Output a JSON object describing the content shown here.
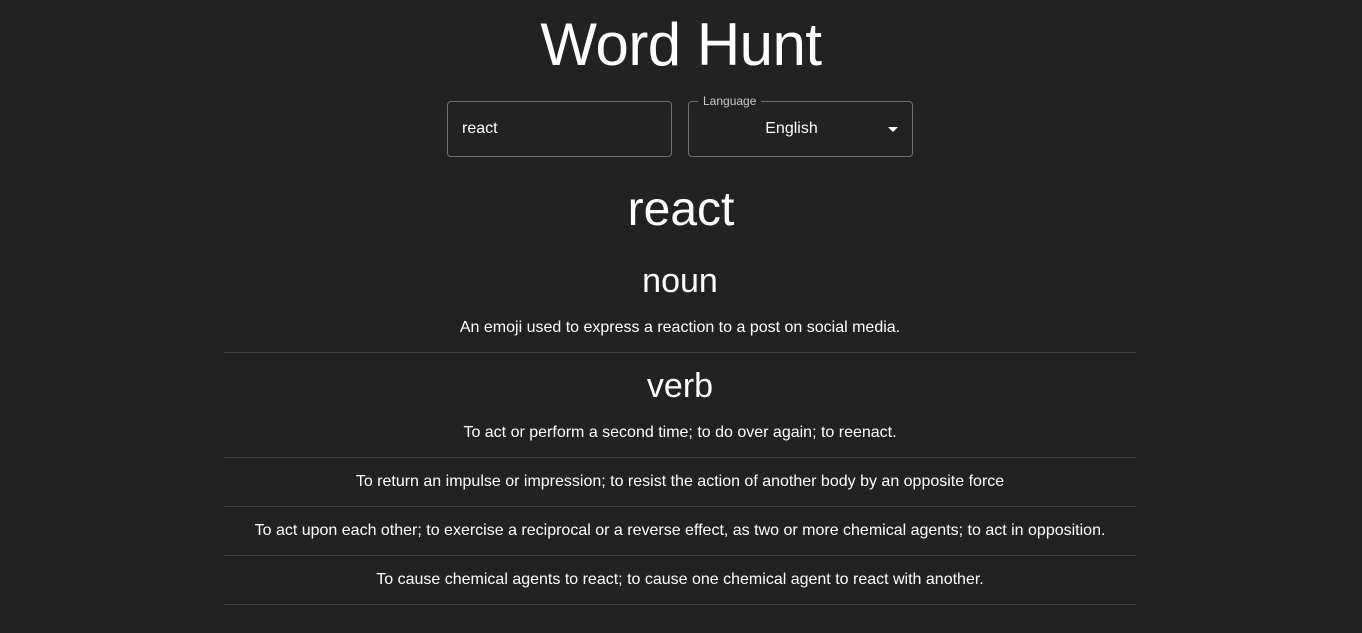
{
  "app": {
    "title": "Word Hunt"
  },
  "search": {
    "value": "react"
  },
  "language": {
    "label": "Language",
    "selected": "English"
  },
  "result": {
    "word": "react",
    "meanings": [
      {
        "part_of_speech": "noun",
        "definitions": [
          "An emoji used to express a reaction to a post on social media."
        ]
      },
      {
        "part_of_speech": "verb",
        "definitions": [
          "To act or perform a second time; to do over again; to reenact.",
          "To return an impulse or impression; to resist the action of another body by an opposite force",
          "To act upon each other; to exercise a reciprocal or a reverse effect, as two or more chemical agents; to act in opposition.",
          "To cause chemical agents to react; to cause one chemical agent to react with another."
        ]
      }
    ]
  },
  "colors": {
    "background": "#222222",
    "text": "#ffffff"
  },
  "icons": {
    "language_dropdown": "caret-down-icon"
  }
}
